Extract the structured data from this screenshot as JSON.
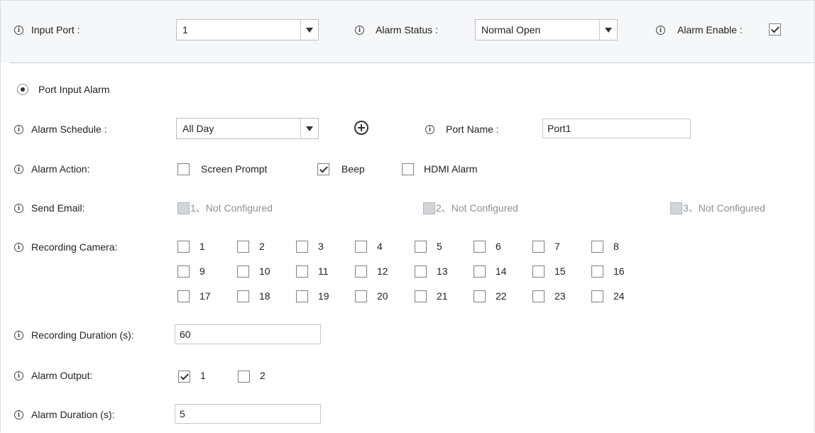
{
  "header": {
    "input_port_label": "Input Port :",
    "input_port_value": "1",
    "alarm_status_label": "Alarm Status :",
    "alarm_status_value": "Normal Open",
    "alarm_enable_label": "Alarm Enable :",
    "alarm_enable_checked": true
  },
  "mode": {
    "label": "Port Input Alarm",
    "selected": true
  },
  "schedule": {
    "label": "Alarm Schedule :",
    "value": "All Day"
  },
  "port_name": {
    "label": "Port Name :",
    "value": "Port1"
  },
  "alarm_action": {
    "label": "Alarm Action:",
    "options": [
      {
        "label": "Screen Prompt",
        "checked": false
      },
      {
        "label": "Beep",
        "checked": true
      },
      {
        "label": "HDMI Alarm",
        "checked": false
      }
    ]
  },
  "send_email": {
    "label": "Send Email:",
    "options": [
      {
        "label": "1、Not Configured",
        "disabled": true
      },
      {
        "label": "2、Not Configured",
        "disabled": true
      },
      {
        "label": "3、Not Configured",
        "disabled": true
      }
    ]
  },
  "recording_camera": {
    "label": "Recording Camera:",
    "cameras": [
      "1",
      "2",
      "3",
      "4",
      "5",
      "6",
      "7",
      "8",
      "9",
      "10",
      "11",
      "12",
      "13",
      "14",
      "15",
      "16",
      "17",
      "18",
      "19",
      "20",
      "21",
      "22",
      "23",
      "24"
    ]
  },
  "recording_duration": {
    "label": "Recording Duration (s):",
    "value": "60"
  },
  "alarm_output": {
    "label": "Alarm Output:",
    "options": [
      {
        "label": "1",
        "checked": true
      },
      {
        "label": "2",
        "checked": false
      }
    ]
  },
  "alarm_duration": {
    "label": "Alarm Duration (s):",
    "value": "5"
  },
  "icons": {
    "info": "i",
    "add": "plus-circle-icon"
  }
}
